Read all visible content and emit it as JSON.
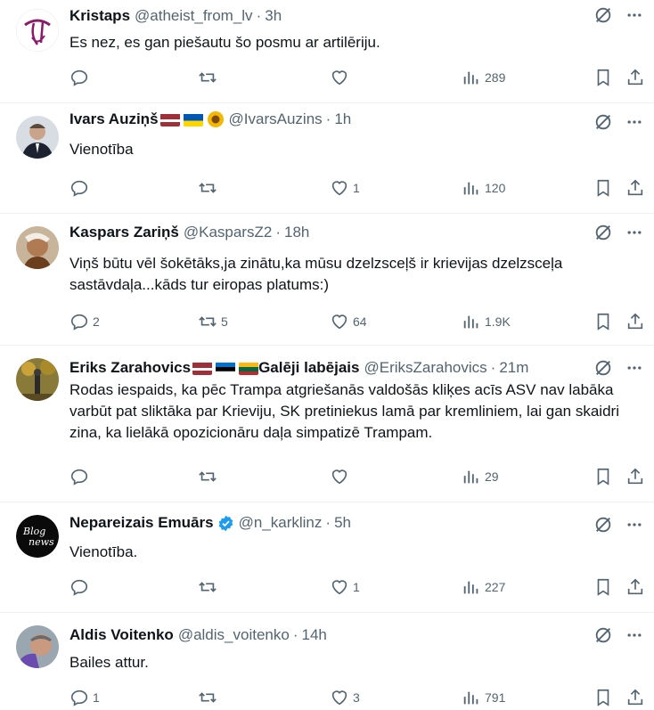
{
  "tweets": [
    {
      "name": "Kristaps",
      "handle": "@atheist_from_lv",
      "time": "3h",
      "text": "Es nez, es gan piešautu šo posmu ar artilēriju.",
      "replies": "",
      "retweets": "",
      "likes": "",
      "views": "289",
      "flags": [],
      "verified": false
    },
    {
      "name": "Ivars Auziņš",
      "handle": "@IvarsAuzins",
      "time": "1h",
      "text": "Vienotība",
      "replies": "",
      "retweets": "",
      "likes": "1",
      "views": "120",
      "flags": [
        "latvia-flag",
        "ukraine-flag",
        "sunflower-emoji"
      ],
      "verified": false
    },
    {
      "name": "Kaspars Zariņš",
      "handle": "@KasparsZ2",
      "time": "18h",
      "text": "Viņš būtu vēl šokētāks,ja zinātu,ka mūsu dzelzsceļš ir krievijas dzelzsceļa sastāvdaļa...kāds tur eiropas platums:)",
      "replies": "2",
      "retweets": "5",
      "likes": "64",
      "views": "1.9K",
      "flags": [],
      "verified": false
    },
    {
      "name": "Eriks Zarahovics",
      "name_suffix": "Galēji labējais",
      "handle": "@EriksZarahovics",
      "time": "21m",
      "text": "Rodas iespaids, ka pēc Trampa atgriešanās valdošās kliķes acīs ASV nav labāka varbūt pat sliktāka par Krieviju, SK pretiniekus lamā par kremliniem, lai gan skaidri zina, ka lielākā opozicionāru daļa simpatizē Trampam.",
      "replies": "",
      "retweets": "",
      "likes": "",
      "views": "29",
      "flags": [
        "latvia-flag",
        "estonia-flag",
        "lithuania-flag"
      ],
      "verified": false
    },
    {
      "name": "Nepareizais Emuārs",
      "handle": "@n_karklinz",
      "time": "5h",
      "text": "Vienotība.",
      "replies": "",
      "retweets": "",
      "likes": "1",
      "views": "227",
      "flags": [],
      "verified": true
    },
    {
      "name": "Aldis Voitenko",
      "handle": "@aldis_voitenko",
      "time": "14h",
      "text": "Bailes attur.",
      "replies": "1",
      "retweets": "",
      "likes": "3",
      "views": "791",
      "flags": [],
      "verified": false
    }
  ],
  "colors": {
    "text": "#0f1419",
    "muted": "#536471",
    "verified": "#1d9bf0",
    "divider": "#eff3f4"
  }
}
